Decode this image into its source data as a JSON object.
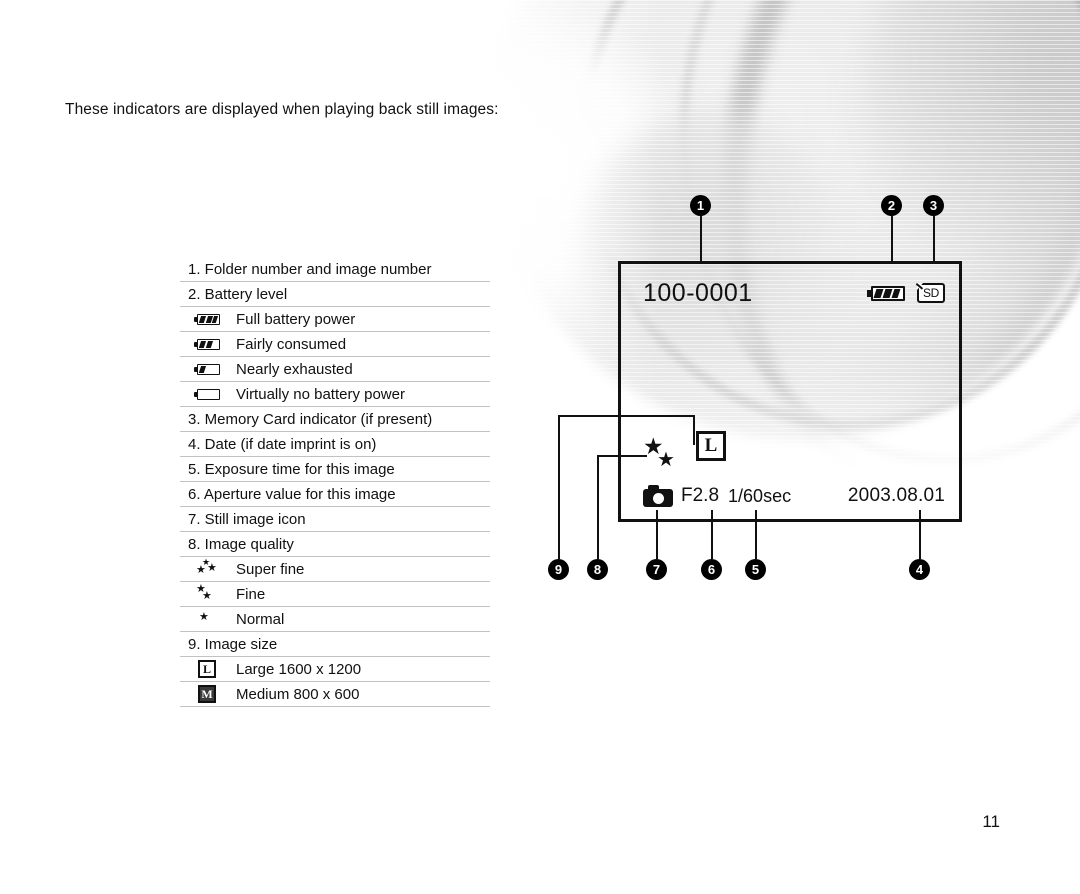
{
  "intro": "These indicators are displayed  when playing back still images:",
  "page_number": "11",
  "legend": {
    "items": [
      {
        "id": "item-1",
        "kind": "head",
        "label": "1. Folder number and image number"
      },
      {
        "id": "item-2",
        "kind": "head",
        "label": "2. Battery level"
      },
      {
        "id": "battery-full",
        "kind": "icon",
        "icon": "battery-full-icon",
        "segments": 3,
        "label": "Full battery power"
      },
      {
        "id": "battery-fairly",
        "kind": "icon",
        "icon": "battery-two-thirds-icon",
        "segments": 2,
        "label": "Fairly consumed"
      },
      {
        "id": "battery-nearly",
        "kind": "icon",
        "icon": "battery-low-icon",
        "segments": 1,
        "label": "Nearly exhausted"
      },
      {
        "id": "battery-empty",
        "kind": "icon",
        "icon": "battery-empty-icon",
        "segments": 0,
        "label": "Virtually no battery power"
      },
      {
        "id": "item-3",
        "kind": "head",
        "label": "3. Memory Card indicator (if present)"
      },
      {
        "id": "item-4",
        "kind": "head",
        "label": "4. Date (if date imprint is on)"
      },
      {
        "id": "item-5",
        "kind": "head",
        "label": "5. Exposure time for this image"
      },
      {
        "id": "item-6",
        "kind": "head",
        "label": "6. Aperture value for this image"
      },
      {
        "id": "item-7",
        "kind": "head",
        "label": "7. Still image icon"
      },
      {
        "id": "item-8",
        "kind": "head",
        "label": "8. Image quality"
      },
      {
        "id": "quality-superfine",
        "kind": "stars",
        "icon": "three-star-icon",
        "stars": 3,
        "label": "Super fine"
      },
      {
        "id": "quality-fine",
        "kind": "stars",
        "icon": "two-star-icon",
        "stars": 2,
        "label": "Fine"
      },
      {
        "id": "quality-normal",
        "kind": "stars",
        "icon": "one-star-icon",
        "stars": 1,
        "label": "Normal"
      },
      {
        "id": "item-9",
        "kind": "head",
        "label": "9. Image size"
      },
      {
        "id": "size-large",
        "kind": "size",
        "icon": "size-large-icon",
        "glyph": "L",
        "label": "Large 1600 x 1200"
      },
      {
        "id": "size-medium",
        "kind": "size",
        "icon": "size-medium-icon",
        "glyph": "M",
        "label": "Medium 800 x 600"
      }
    ]
  },
  "lcd": {
    "file_number": "100-0001",
    "battery_icon": "battery-full-icon",
    "battery_segments": 3,
    "card_label": "SD",
    "quality_icon": "two-star-icon",
    "size_glyph": "L",
    "still_image_icon": "camera-icon",
    "aperture": "F2.8",
    "shutter": "1/60sec",
    "date": "2003.08.01"
  },
  "callouts": [
    {
      "n": "1",
      "target": "folder-and-image-number"
    },
    {
      "n": "2",
      "target": "battery-level"
    },
    {
      "n": "3",
      "target": "memory-card-indicator"
    },
    {
      "n": "4",
      "target": "date"
    },
    {
      "n": "5",
      "target": "exposure-time"
    },
    {
      "n": "6",
      "target": "aperture-value"
    },
    {
      "n": "7",
      "target": "still-image-icon"
    },
    {
      "n": "8",
      "target": "image-quality"
    },
    {
      "n": "9",
      "target": "image-size"
    }
  ]
}
